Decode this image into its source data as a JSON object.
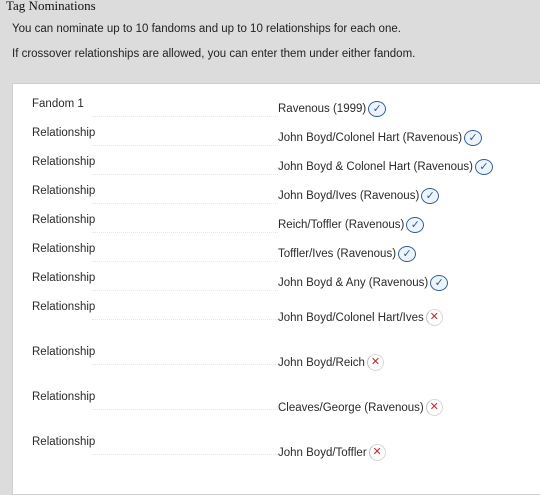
{
  "fieldset": {
    "legend": "Tag Nominations",
    "notes": [
      "You can nominate up to 10 fandoms and up to 10 relationships for each one.",
      "If crossover relationships are allowed, you can enter them under either fandom."
    ]
  },
  "rows": [
    {
      "label": "Fandom 1",
      "value": "Ravenous (1999)",
      "status": "approved",
      "icon": "check-icon"
    },
    {
      "label": "Relationship",
      "value": "John Boyd/Colonel Hart (Ravenous)",
      "status": "approved",
      "icon": "check-icon"
    },
    {
      "label": "Relationship",
      "value": "John Boyd & Colonel Hart (Ravenous)",
      "status": "approved",
      "icon": "check-icon"
    },
    {
      "label": "Relationship",
      "value": "John Boyd/Ives (Ravenous)",
      "status": "approved",
      "icon": "check-icon"
    },
    {
      "label": "Relationship",
      "value": "Reich/Toffler (Ravenous)",
      "status": "approved",
      "icon": "check-icon"
    },
    {
      "label": "Relationship",
      "value": "Toffler/Ives (Ravenous)",
      "status": "approved",
      "icon": "check-icon"
    },
    {
      "label": "Relationship",
      "value": "John Boyd & Any (Ravenous)",
      "status": "approved",
      "icon": "check-icon"
    },
    {
      "label": "Relationship",
      "value": "John Boyd/Colonel Hart/Ives",
      "status": "rejected",
      "icon": "cross-icon"
    },
    {
      "label": "Relationship",
      "value": "John Boyd/Reich",
      "status": "rejected",
      "icon": "cross-icon"
    },
    {
      "label": "Relationship",
      "value": "Cleaves/George (Ravenous)",
      "status": "rejected",
      "icon": "cross-icon"
    },
    {
      "label": "Relationship",
      "value": "John Boyd/Toffler",
      "status": "rejected",
      "icon": "cross-icon"
    }
  ],
  "icons": {
    "approved": "✓",
    "rejected": "✕"
  },
  "colors": {
    "approved": "#2e5c98",
    "rejected": "#c0282d",
    "page_bg": "#dcdcdc",
    "panel_bg": "#ffffff"
  }
}
